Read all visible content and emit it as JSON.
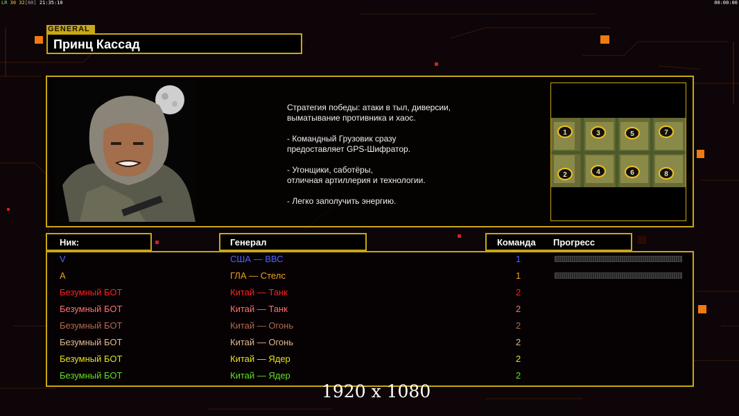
{
  "status_bar": {
    "fps_label": "LR",
    "fps_values": "30 32",
    "fps_bracket": "[60]",
    "clock": "21:35:10",
    "timer": "00:00:00"
  },
  "general_panel": {
    "tag": "GENERAL",
    "name": "Принц Кассад",
    "description": "Стратегия победы: атаки в тыл, диверсии,\n выматывание противника и хаос.\n\n- Командный Грузовик сразу\nпредоставляет GPS-Шифратор.\n\n- Угонщики, саботёры,\nотличная артиллерия и технологии.\n\n- Легко заполучить энергию.",
    "portrait_icon": "general-portrait",
    "map_icon": "map-preview",
    "map_slots": [
      "1",
      "3",
      "5",
      "7",
      "2",
      "4",
      "6",
      "8"
    ]
  },
  "table": {
    "headers": {
      "nick": "Ник:",
      "general": "Генерал",
      "team": "Команда",
      "progress": "Прогресс"
    },
    "rows": [
      {
        "nick": "V",
        "general": "США — ВВС",
        "team": "1",
        "color": "#5060ff",
        "progress": 0
      },
      {
        "nick": "A",
        "general": "ГЛА — Стелс",
        "team": "1",
        "color": "#f0a020",
        "progress": 0
      },
      {
        "nick": "Безумный БОТ",
        "general": "Китай — Танк",
        "team": "2",
        "color": "#ff2020"
      },
      {
        "nick": "Безумный БОТ",
        "general": "Китай — Танк",
        "team": "2",
        "color": "#ff7070"
      },
      {
        "nick": "Безумный БОТ",
        "general": "Китай — Огонь",
        "team": "2",
        "color": "#b06a50"
      },
      {
        "nick": "Безумный БОТ",
        "general": "Китай — Огонь",
        "team": "2",
        "color": "#e0b890"
      },
      {
        "nick": "Безумный БОТ",
        "general": "Китай — Ядер",
        "team": "2",
        "color": "#e8e020"
      },
      {
        "nick": "Безумный БОТ",
        "general": "Китай — Ядер",
        "team": "2",
        "color": "#60e020"
      }
    ]
  },
  "resolution_text": "1920 x 1080",
  "colors": {
    "frame": "#c8a814",
    "accent": "#f07a10",
    "background": "#0c0406"
  }
}
